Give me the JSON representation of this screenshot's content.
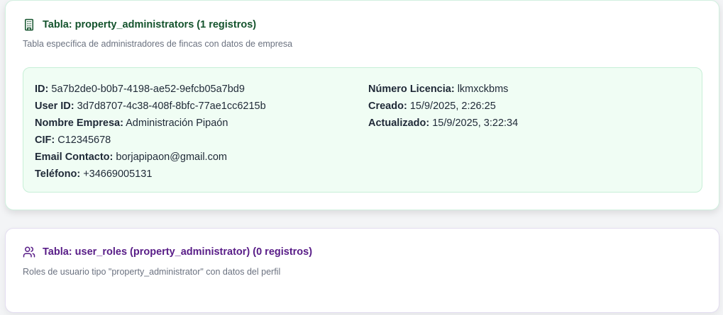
{
  "tables": [
    {
      "title": "Tabla: property_administrators (1 registros)",
      "description": "Tabla específica de administradores de fincas con datos de empresa",
      "icon": "building-icon",
      "color": "#14532d",
      "record": {
        "left": [
          {
            "label": "ID:",
            "value": "5a7b2de0-b0b7-4198-ae52-9efcb05a7bd9"
          },
          {
            "label": "User ID:",
            "value": "3d7d8707-4c38-408f-8bfc-77ae1cc6215b"
          },
          {
            "label": "Nombre Empresa:",
            "value": "Administración Pipaón"
          },
          {
            "label": "CIF:",
            "value": "C12345678"
          },
          {
            "label": "Email Contacto:",
            "value": "borjapipaon@gmail.com"
          },
          {
            "label": "Teléfono:",
            "value": "+34669005131"
          }
        ],
        "right": [
          {
            "label": "Número Licencia:",
            "value": "lkmxckbms"
          },
          {
            "label": "Creado:",
            "value": "15/9/2025, 2:26:25"
          },
          {
            "label": "Actualizado:",
            "value": "15/9/2025, 3:22:34"
          }
        ]
      }
    },
    {
      "title": "Tabla: user_roles (property_administrator) (0 registros)",
      "description": "Roles de usuario tipo \"property_administrator\" con datos del perfil",
      "icon": "users-icon",
      "color": "#581c87"
    }
  ]
}
